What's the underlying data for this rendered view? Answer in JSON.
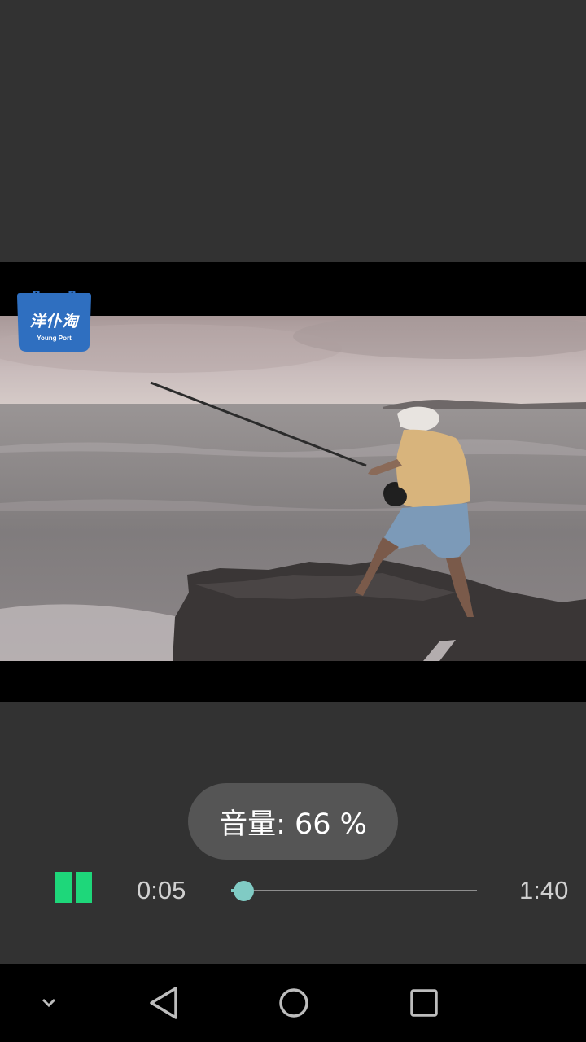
{
  "logo": {
    "cn_text": "洋仆淘",
    "en_text": "Young Port",
    "color": "#2f6fc0"
  },
  "volume_toast": {
    "text": "音量: 66 %",
    "level_percent": 66
  },
  "player": {
    "state": "playing",
    "current_time": "0:05",
    "total_time": "1:40",
    "progress_fraction": 0.05,
    "accent_color": "#1ed77a",
    "seek_color": "#80cbc4"
  },
  "nav": {
    "items": [
      "chevron-down-icon",
      "back-icon",
      "home-icon",
      "recents-icon"
    ]
  }
}
